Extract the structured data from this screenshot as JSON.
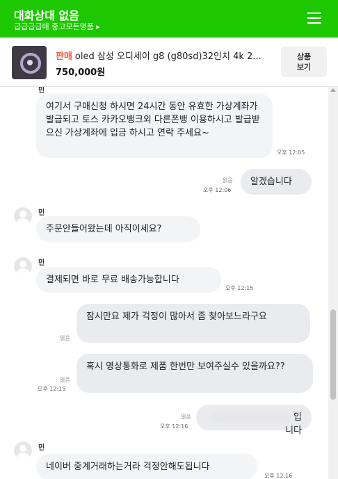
{
  "header": {
    "title": "대화상대 없음",
    "subtitle": "급급급급매 중고모든명품 ▸"
  },
  "product": {
    "tag": "판매",
    "title": "oled 삼성 오디세이 g8 (g80sd)32인치 4k 2...",
    "price": "750,000원",
    "view_button": "상품\n보기"
  },
  "messages": [
    {
      "text": "여기서 구매신청 하시면 24시간 동안 유효한 가상계좌가 발급되고 토스 카카오뱅크외 다른폰뱅 이용하시고 발급받으신 가상계좌에 입금 하시고 연락 주세요~",
      "time": "오후 12:05"
    },
    {
      "text": "알겠습니다",
      "read": "읽음",
      "time": "오후 12:06"
    },
    {
      "sender": "민",
      "text": "주문안들어왔는데 아직이세요?"
    },
    {
      "sender": "민",
      "text": "결제되면 바로 무료 배송가능합니다",
      "time": "오후 12:15"
    },
    {
      "text": "잠시만요 제가 걱정이 많아서 좀 찾아보느라구요",
      "read": "읽음"
    },
    {
      "text": "혹시 영상통화로 제품 한번만 보여주실수 있을까요??",
      "read": "읽음",
      "time": "오후 12:15"
    },
    {
      "text": "입니다",
      "read": "읽음",
      "time": "오후 12:16"
    },
    {
      "sender": "민",
      "text": "네이버 중계거래하는거라 걱정안해도됩니다",
      "time": "오후 12:16"
    }
  ],
  "top_partial_name": "민"
}
